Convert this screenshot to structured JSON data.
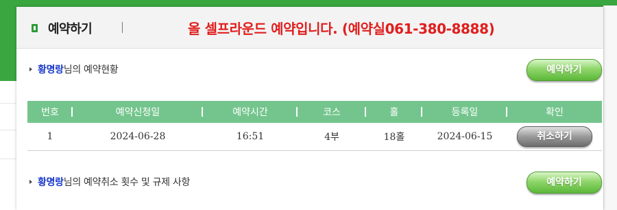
{
  "header": {
    "title": "예약하기",
    "separator": "|",
    "notice": "올 셀프라운드 예약입니다. (예약실061-380-8888)"
  },
  "status_section": {
    "user_name": "황명랑",
    "label_suffix": "님의 예약현황",
    "reserve_button": "예약하기"
  },
  "table": {
    "columns": [
      "번호",
      "예약신청일",
      "예약시간",
      "코스",
      "홀",
      "등록일",
      "확인"
    ],
    "rows": [
      {
        "no": "1",
        "request_date": "2024-06-28",
        "time": "16:51",
        "course": "4부",
        "holes": "18홀",
        "registered": "2024-06-15",
        "action": "취소하기"
      }
    ]
  },
  "cancel_section": {
    "user_name": "황명랑",
    "label_suffix": "님의 예약취소 횟수 및 규제 사항",
    "reserve_button": "예약하기"
  },
  "colors": {
    "brand_green": "#3aa63f",
    "table_header": "#74c58d",
    "notice_red": "#e01e1e",
    "name_blue": "#1a39c9"
  }
}
